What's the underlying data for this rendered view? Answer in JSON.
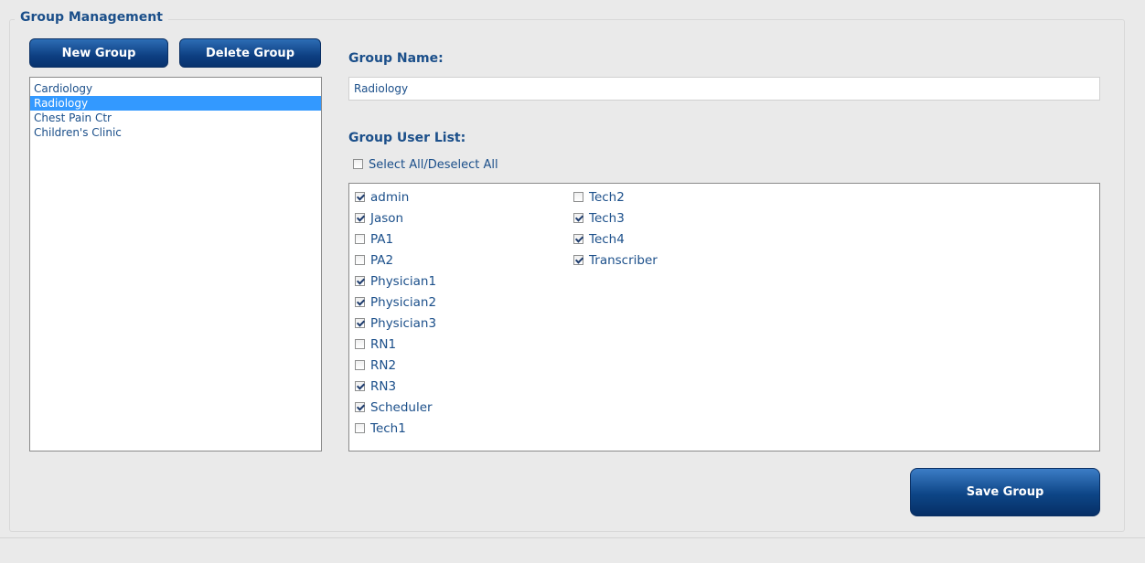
{
  "section_title": "Group Management",
  "buttons": {
    "new_group": "New Group",
    "delete_group": "Delete Group",
    "save_group": "Save Group"
  },
  "groups": [
    {
      "label": "Cardiology",
      "selected": false
    },
    {
      "label": "Radiology",
      "selected": true
    },
    {
      "label": "Chest Pain Ctr",
      "selected": false
    },
    {
      "label": "Children's Clinic",
      "selected": false
    }
  ],
  "group_name": {
    "label": "Group Name:",
    "value": "Radiology"
  },
  "user_list": {
    "label": "Group User List:",
    "select_all_label": "Select All/Deselect All",
    "select_all_checked": false,
    "columns": [
      [
        {
          "name": "admin",
          "checked": true
        },
        {
          "name": "Jason",
          "checked": true
        },
        {
          "name": "PA1",
          "checked": false
        },
        {
          "name": "PA2",
          "checked": false
        },
        {
          "name": "Physician1",
          "checked": true
        },
        {
          "name": "Physician2",
          "checked": true
        },
        {
          "name": "Physician3",
          "checked": true
        },
        {
          "name": "RN1",
          "checked": false
        },
        {
          "name": "RN2",
          "checked": false
        },
        {
          "name": "RN3",
          "checked": true
        },
        {
          "name": "Scheduler",
          "checked": true
        },
        {
          "name": "Tech1",
          "checked": false
        }
      ],
      [
        {
          "name": "Tech2",
          "checked": false
        },
        {
          "name": "Tech3",
          "checked": true
        },
        {
          "name": "Tech4",
          "checked": true
        },
        {
          "name": "Transcriber",
          "checked": true
        }
      ]
    ]
  }
}
